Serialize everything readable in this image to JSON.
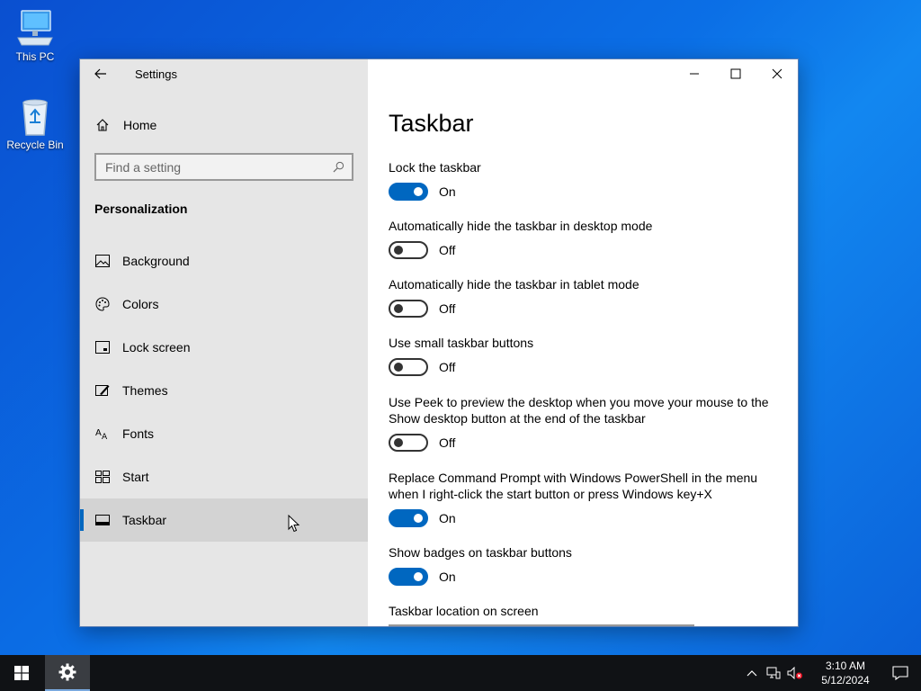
{
  "desktop": {
    "icons": [
      {
        "label": "This PC"
      },
      {
        "label": "Recycle Bin"
      }
    ]
  },
  "window": {
    "title": "Settings",
    "accent_color": "#0067c0",
    "sidebar": {
      "home_label": "Home",
      "search_placeholder": "Find a setting",
      "section": "Personalization",
      "items": [
        {
          "label": "Background",
          "icon": "picture-icon"
        },
        {
          "label": "Colors",
          "icon": "palette-icon"
        },
        {
          "label": "Lock screen",
          "icon": "lock-screen-icon"
        },
        {
          "label": "Themes",
          "icon": "themes-icon"
        },
        {
          "label": "Fonts",
          "icon": "fonts-icon"
        },
        {
          "label": "Start",
          "icon": "start-icon"
        },
        {
          "label": "Taskbar",
          "icon": "taskbar-icon",
          "active": true
        }
      ]
    },
    "main": {
      "title": "Taskbar",
      "settings": [
        {
          "label": "Lock the taskbar",
          "state": "On"
        },
        {
          "label": "Automatically hide the taskbar in desktop mode",
          "state": "Off"
        },
        {
          "label": "Automatically hide the taskbar in tablet mode",
          "state": "Off"
        },
        {
          "label": "Use small taskbar buttons",
          "state": "Off"
        },
        {
          "label": "Use Peek to preview the desktop when you move your mouse to the Show desktop button at the end of the taskbar",
          "state": "Off"
        },
        {
          "label": "Replace Command Prompt with Windows PowerShell in the menu when I right-click the start button or press Windows key+X",
          "state": "On"
        },
        {
          "label": "Show badges on taskbar buttons",
          "state": "On"
        }
      ],
      "location_label": "Taskbar location on screen"
    }
  },
  "taskbar": {
    "time": "3:10 AM",
    "date": "5/12/2024"
  }
}
